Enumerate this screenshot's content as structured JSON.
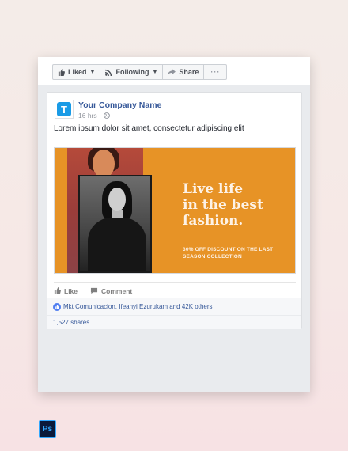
{
  "toolbar": {
    "liked_label": "Liked",
    "following_label": "Following",
    "share_label": "Share",
    "more_label": "···"
  },
  "post": {
    "page_name": "Your Company Name",
    "logo_letter": "T",
    "time": "16 hrs",
    "separator": "·",
    "text": "Lorem ipsum dolor sit amet, consectetur adipiscing elit"
  },
  "banner": {
    "headline_line1": "Live life",
    "headline_line2": "in the best",
    "headline_line3": "fashion.",
    "sub_line1": "30% OFF DISCOUNT ON THE LAST",
    "sub_line2": "SEASON COLLECTION",
    "background_color": "#e79326"
  },
  "actions": {
    "like_label": "Like",
    "comment_label": "Comment"
  },
  "reactions": {
    "text": "Mkt Comunicacion, Ifeanyi Ezurukam and 42K others",
    "shares": "1,527 shares"
  },
  "badge": {
    "label": "Ps"
  },
  "colors": {
    "link": "#365899",
    "accent": "#1a9be6",
    "banner": "#e79326"
  }
}
